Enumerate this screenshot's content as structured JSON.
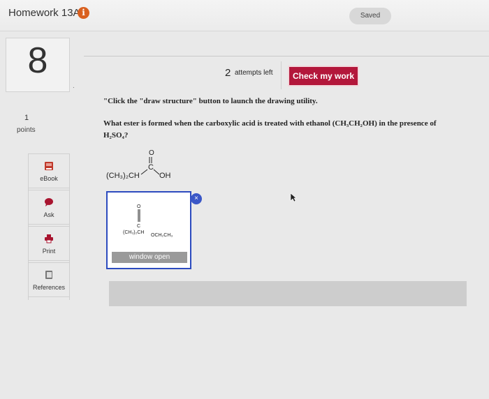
{
  "header": {
    "title": "Homework 13A",
    "info_icon": "info-icon",
    "saved": "Saved"
  },
  "question": {
    "number": "8",
    "dot": ".",
    "points_value": "1",
    "points_label": "points",
    "attempts_count": "2",
    "attempts_label": "attempts left",
    "check_button": "Check my work",
    "instruction": "\"Click the \"draw structure\" button to launch the drawing utility.",
    "text_line1": "What ester is formed when the carboxylic acid is treated with ethanol (CH₃CH₂OH) in the presence of",
    "text_line2": "H₂SO₄?",
    "acid_left": "(CH₃)₂CH",
    "acid_right": "OH",
    "acid_o": "O",
    "acid_c": "C",
    "thumb_left": "(CH₃)₂CH",
    "thumb_right": "OCH₂CH₃",
    "thumb_o": "O",
    "thumb_c": "C",
    "window_open": "window open",
    "close_x": "×"
  },
  "sidebar": {
    "tools": [
      {
        "label": "eBook",
        "icon": "book-icon",
        "color": "#c0392b"
      },
      {
        "label": "Ask",
        "icon": "chat-bubble-icon",
        "color": "#a8142f"
      },
      {
        "label": "Print",
        "icon": "printer-icon",
        "color": "#a8142f"
      },
      {
        "label": "References",
        "icon": "folder-icon",
        "color": "#555555"
      }
    ]
  },
  "colors": {
    "accent": "#b3173b",
    "info": "#d9601f",
    "canvas_border": "#2c4bbf"
  }
}
